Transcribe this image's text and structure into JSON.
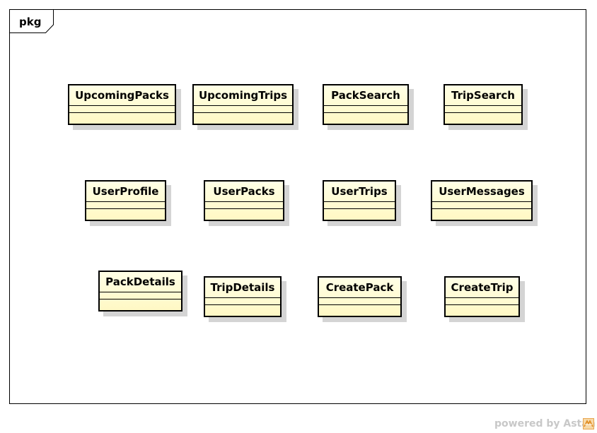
{
  "package": {
    "label": "pkg"
  },
  "classes": [
    {
      "name": "UpcomingPacks"
    },
    {
      "name": "UpcomingTrips"
    },
    {
      "name": "PackSearch"
    },
    {
      "name": "TripSearch"
    },
    {
      "name": "UserProfile"
    },
    {
      "name": "UserPacks"
    },
    {
      "name": "UserTrips"
    },
    {
      "name": "UserMessages"
    },
    {
      "name": "PackDetails"
    },
    {
      "name": "TripDetails"
    },
    {
      "name": "CreatePack"
    },
    {
      "name": "CreateTrip"
    }
  ],
  "watermark": {
    "text": "powered by Astah",
    "icon": "astah-logo-icon"
  },
  "colors": {
    "class_fill": "#fff8c4",
    "class_border": "#000000",
    "shadow": "#d4d4d4",
    "watermark": "#c8c8c8"
  }
}
